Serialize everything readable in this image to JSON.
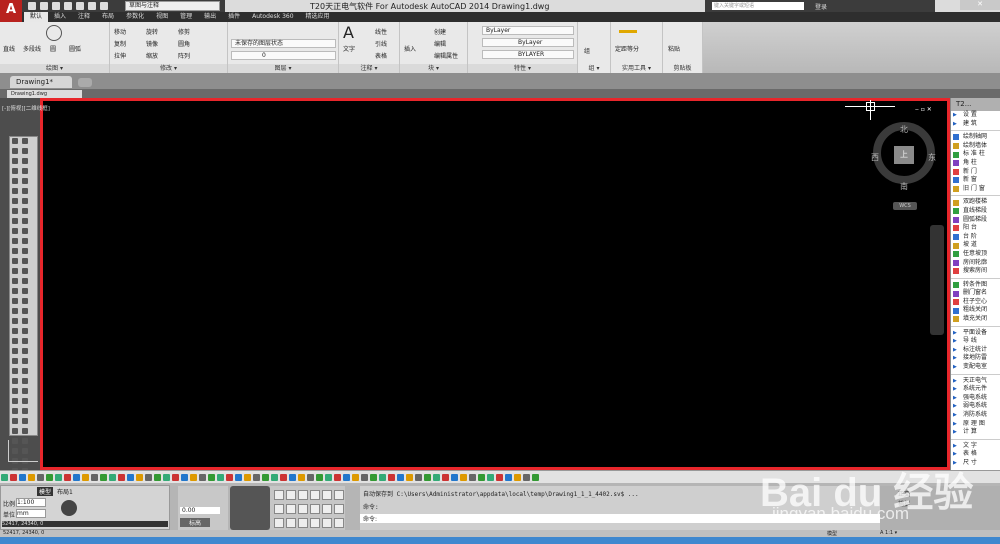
{
  "app": {
    "logo": "A",
    "title": "T20天正电气软件 For Autodesk AutoCAD 2014   Drawing1.dwg",
    "workspace": "草图与注释",
    "search_placeholder": "键入关键字或短语",
    "login": "登录",
    "close": "✕"
  },
  "ribbon_tabs": [
    "默认",
    "插入",
    "注释",
    "布局",
    "参数化",
    "视图",
    "管理",
    "输出",
    "插件",
    "Autodesk 360",
    "精选应用"
  ],
  "panels": {
    "draw": {
      "title": "绘图 ▾",
      "tools": [
        "直线",
        "多段线",
        "圆",
        "圆弧"
      ]
    },
    "modify": {
      "title": "修改 ▾",
      "tools": [
        "移动",
        "旋转",
        "修剪",
        "复制",
        "镜像",
        "圆角",
        "拉伸",
        "缩放",
        "阵列"
      ]
    },
    "layers": {
      "title": "图层 ▾",
      "state": "未保存的图层状态",
      "current": "0"
    },
    "annotation": {
      "title": "注释 ▾",
      "tools": [
        "文字",
        "线性",
        "引线",
        "表格"
      ]
    },
    "block": {
      "title": "块 ▾",
      "tools": [
        "插入",
        "创建",
        "编辑",
        "编辑属性"
      ]
    },
    "properties": {
      "title": "特性 ▾",
      "color": "ByLayer",
      "linetype": "ByLayer",
      "lineweight": "BYLAYER"
    },
    "group": {
      "title": "组 ▾",
      "tool": "组"
    },
    "utilities": {
      "title": "实用工具 ▾",
      "tool": "定距等分"
    },
    "clipboard": {
      "title": "剪贴板",
      "tool": "粘贴"
    }
  },
  "doc_tab": "Drawing1*",
  "file_tab": "Drawing1.dwg",
  "viewport": {
    "label": "[-][俯视][二维线框]",
    "north": "北",
    "south": "南",
    "east": "东",
    "west": "西",
    "top": "上",
    "wcs": "WCS",
    "controls": "‒ ▫ ✕"
  },
  "palette": {
    "title": "T2...",
    "groups": [
      [
        "设 置",
        "建 筑"
      ],
      [
        "绘制轴网",
        "绘制墙体",
        "标 准 柱",
        "角 柱",
        "新 门",
        "新 窗",
        "旧 门 窗"
      ],
      [
        "双跑楼梯",
        "直线梯段",
        "圆弧梯段",
        "阳 台",
        "台 阶",
        "坡 道",
        "任意坡顶",
        "房间轮廓",
        "搜索房间"
      ],
      [
        "转条件图",
        "删门窗名",
        "柱子空心",
        "粗线关闭",
        "填充关闭"
      ],
      [
        "平面设备",
        "导 线",
        "标注统计",
        "接地防雷",
        "变配电室"
      ],
      [
        "天正电气",
        "系统元件",
        "强电系统",
        "弱电系统",
        "消防系统",
        "原 理 图",
        "计 算"
      ],
      [
        "文 字",
        "表 格",
        "尺 寸"
      ]
    ]
  },
  "layout_panel": {
    "tabs": [
      "模型",
      "布局1"
    ],
    "scale_label": "比例",
    "scale": "1:100",
    "unit_label": "单位",
    "unit": "mm",
    "coords": "52417, 24340, 0"
  },
  "elevation": {
    "value": "0.00",
    "label": "标高"
  },
  "command": {
    "history": "自动保存到 C:\\Users\\Administrator\\appdata\\local\\temp\\Drawing1_1_1_4402.sv$ ...",
    "line1": "命令:",
    "prompt": "命令:"
  },
  "osnap": {
    "ortho": "正交",
    "snap": "捕捉"
  },
  "status": {
    "coords": "52417, 24340, 0",
    "model": "模型",
    "anno_scale": "A 1:1 ▾"
  },
  "watermark": {
    "brand": "Bai du 经验",
    "url": "jingyan.baidu.com"
  },
  "colors": {
    "frame": "#e8262b",
    "canvas": "#000000",
    "taskbar": "#3f88cf"
  }
}
